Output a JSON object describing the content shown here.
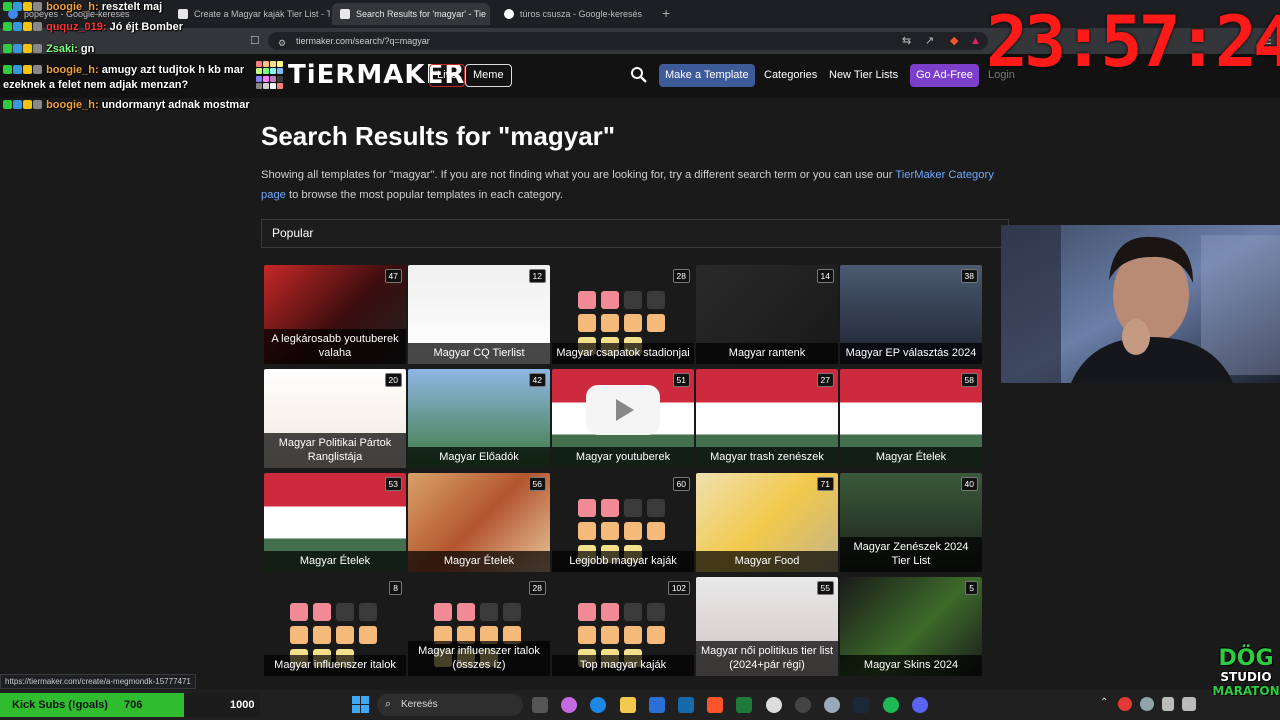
{
  "browser": {
    "tabs": [
      {
        "label": "popeyes - Google-keresés"
      },
      {
        "label": "Create a Magyar kaják Tier List - Tier"
      },
      {
        "label": "Search Results for 'magyar' - Tie"
      },
      {
        "label": "túros csusza - Google-keresés"
      }
    ],
    "url": "tiermaker.com/search/?q=magyar"
  },
  "site": {
    "logo_text": "TiERMAKER",
    "nav": {
      "live": "Live",
      "meme": "Meme",
      "make_template": "Make a Template",
      "categories": "Categories",
      "new_tier_lists": "New Tier Lists",
      "go_ad_free": "Go Ad-Free",
      "login": "Login"
    }
  },
  "page": {
    "title": "Search Results for \"magyar\"",
    "desc_before": "Showing all templates for \"magyar\". If you are not finding what you are looking for, try a different search term or you can use our ",
    "desc_link": "TierMaker Category page",
    "desc_after": " to browse the most popular templates in each category.",
    "section": "Popular"
  },
  "cards": [
    {
      "title": "A legkárosabb youtuberek valaha",
      "count": "47"
    },
    {
      "title": "Magyar CQ Tierlist",
      "count": "12"
    },
    {
      "title": "Magyar csapatok stadionjai",
      "count": "28"
    },
    {
      "title": "Magyar rantenk",
      "count": "14"
    },
    {
      "title": "Magyar EP választás 2024",
      "count": "38"
    },
    {
      "title": "Magyar Politikai Pártok Ranglistája",
      "count": "20"
    },
    {
      "title": "Magyar Előadók",
      "count": "42"
    },
    {
      "title": "Magyar youtuberek",
      "count": "51"
    },
    {
      "title": "Magyar trash zenészek",
      "count": "27"
    },
    {
      "title": "Magyar Ételek",
      "count": "58"
    },
    {
      "title": "Magyar Ételek",
      "count": "53"
    },
    {
      "title": "Magyar Ételek",
      "count": "56"
    },
    {
      "title": "Legjobb magyar kaják",
      "count": "60"
    },
    {
      "title": "Magyar Food",
      "count": "71"
    },
    {
      "title": "Magyar Zenészek 2024 Tier List",
      "count": "40"
    },
    {
      "title": "Magyar influenszer italok",
      "count": "8"
    },
    {
      "title": "Magyar influenszer italok (összes íz)",
      "count": "28"
    },
    {
      "title": "Top magyar kaják",
      "count": "102"
    },
    {
      "title": "Magyar női politikus tier list (2024+pár régi)",
      "count": "55"
    },
    {
      "title": "Magyar Skins 2024",
      "count": "5"
    }
  ],
  "chat": [
    {
      "user": "boogie_h:",
      "msg": "resztelt maj"
    },
    {
      "user": "ququz_019:",
      "msg": "Jó éjt Bomber"
    },
    {
      "user": "Zsaki:",
      "msg": "gn"
    },
    {
      "user": "boogie_h:",
      "msg": "amugy azt tudjtok h kb mar"
    },
    {
      "user": "",
      "msg": "ezeknek a felet nem adjak menzan?"
    },
    {
      "user": "boogie_h:",
      "msg": "undormanyt adnak mostmar"
    }
  ],
  "overlay": {
    "clock": "23:57:24",
    "kick_label": "Kick Subs (!goals)",
    "kick_current": "706",
    "kick_goal": "1000",
    "kick_progress": 0.706,
    "studio_line1": "DÖG",
    "studio_line2": "STUDIO",
    "studio_line3": "MARATON"
  },
  "status_url": "https://tiermaker.com/create/a-megmondk-15777471",
  "taskbar": {
    "search_placeholder": "Keresés"
  },
  "colors": {
    "accent_blue": "#3d5a99",
    "accent_purple": "#7b3fc9",
    "live_red": "#c62828",
    "link": "#6ea8fe",
    "clock_red": "#ff1a1a",
    "kick_green": "#2fbd2f"
  }
}
